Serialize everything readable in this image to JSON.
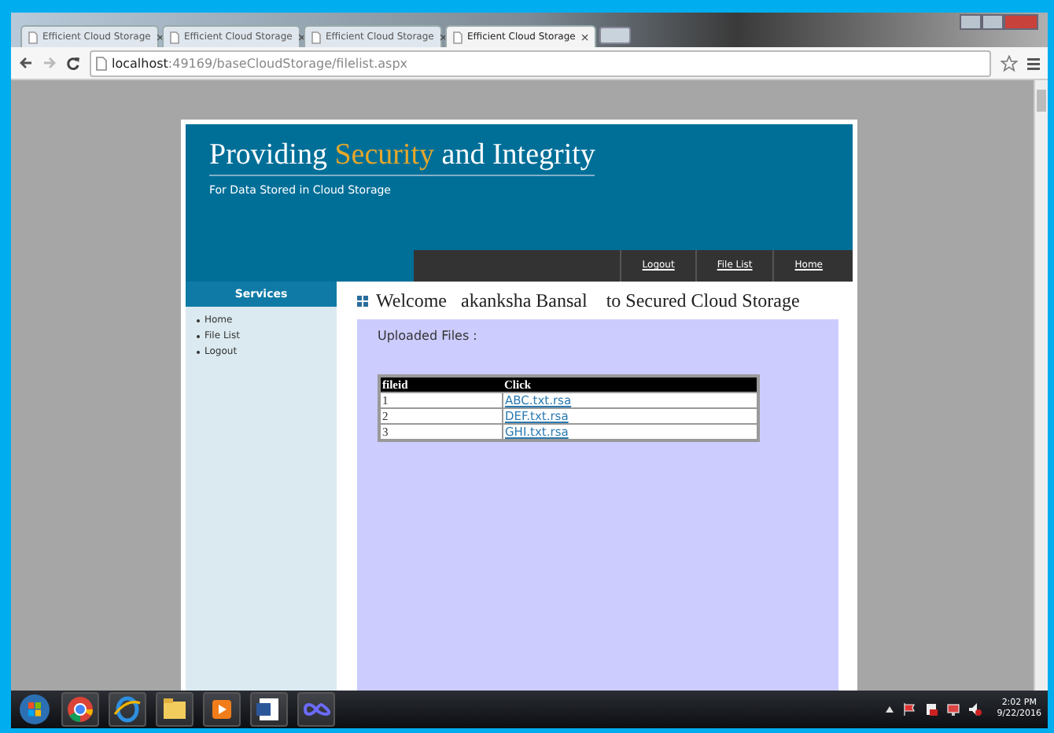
{
  "browser": {
    "tabs": [
      {
        "label": "Efficient Cloud Storage",
        "close": "×",
        "selected": false
      },
      {
        "label": "Efficient Cloud Storage",
        "close": "×",
        "selected": false
      },
      {
        "label": "Efficient Cloud Storage",
        "close": "×",
        "selected": false
      },
      {
        "label": "Efficient Cloud Storage",
        "close": "×",
        "selected": true
      }
    ],
    "address": {
      "host": "localhost",
      "path": ":49169/baseCloudStorage/filelist.aspx"
    }
  },
  "page": {
    "title": [
      {
        "text": "Providing ",
        "highlight": false
      },
      {
        "text": "Security",
        "highlight": true
      },
      {
        "text": " and Integrity",
        "highlight": false
      }
    ],
    "subtitle": "For Data Stored in Cloud Storage",
    "nav": [
      "Logout",
      "File List",
      "Home"
    ],
    "sidebar": {
      "heading": "Services",
      "items": [
        "Home",
        "File List",
        "Logout"
      ]
    },
    "welcome": "Welcome   akanksha Bansal    to Secured Cloud Storage",
    "uploaded_label": "Uploaded Files :",
    "table": {
      "columns": [
        "fileid",
        "Click"
      ],
      "rows": [
        [
          "1",
          "ABC.txt.rsa"
        ],
        [
          "2",
          "DEF.txt.rsa"
        ],
        [
          "3",
          "GHI.txt.rsa"
        ]
      ]
    }
  },
  "taskbar": {
    "time": "2:02 PM",
    "date": "9/22/2016"
  }
}
